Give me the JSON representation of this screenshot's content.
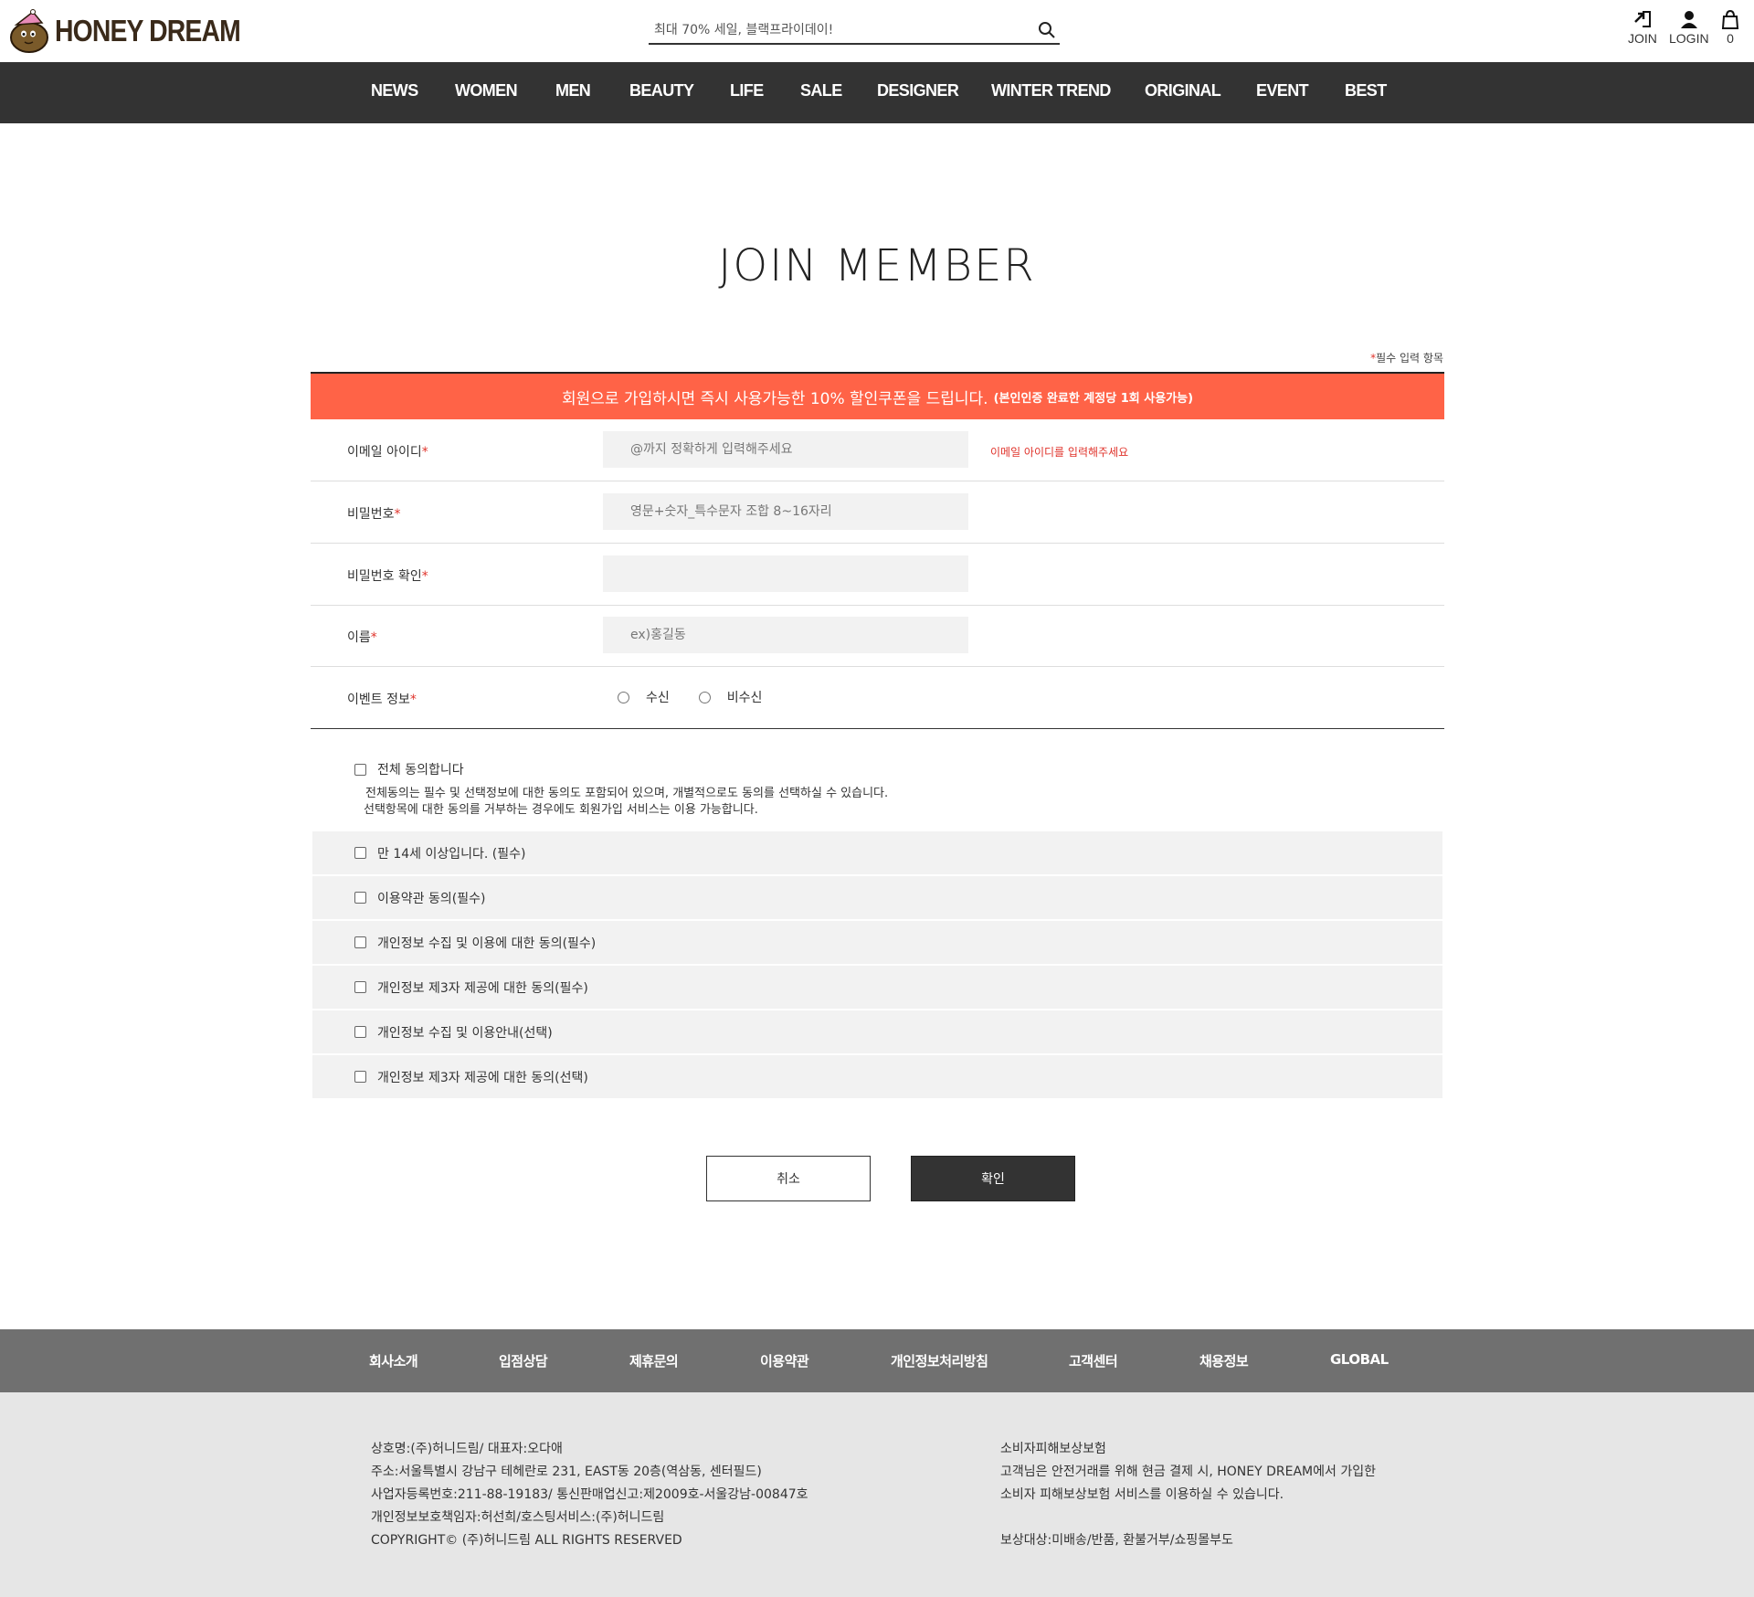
{
  "header": {
    "logo_text": "HONEY DREAM",
    "search_placeholder": "최대 70% 세일, 블랙프라이데이!",
    "join_label": "JOIN",
    "login_label": "LOGIN",
    "cart_count": "0"
  },
  "nav": {
    "items": [
      "NEWS",
      "WOMEN",
      "MEN",
      "BEAUTY",
      "LIFE",
      "SALE",
      "DESIGNER",
      "WINTER TREND",
      "ORIGINAL",
      "EVENT",
      "BEST"
    ]
  },
  "page": {
    "title": "JOIN MEMBER",
    "required_star": "*",
    "required_note": "필수 입력 항목",
    "banner_main": "회원으로 가입하시면 즉시 사용가능한 10% 할인쿠폰을 드립니다.",
    "banner_sub": "(본인인증 완료한 계정당 1회 사용가능)"
  },
  "form": {
    "email": {
      "label": "이메일 아이디",
      "placeholder": "@까지 정확하게 입력해주세요",
      "error": "이메일 아이디를 입력해주세요"
    },
    "password": {
      "label": "비밀번호",
      "placeholder": "영문+숫자_특수문자 조합 8~16자리"
    },
    "password_confirm": {
      "label": "비밀번호 확인",
      "placeholder": ""
    },
    "name": {
      "label": "이름",
      "placeholder": "ex)홍길동"
    },
    "event": {
      "label": "이벤트 정보",
      "option_yes": "수신",
      "option_no": "비수신"
    }
  },
  "agreements": {
    "all_label": "전체 동의합니다",
    "all_desc_1": "전체동의는 필수 및 선택정보에 대한 동의도 포함되어 있으며, 개별적으로도 동의를 선택하실 수 있습니다.",
    "all_desc_2": "선택항목에 대한 동의를 거부하는 경우에도 회원가입 서비스는 이용 가능합니다.",
    "items": [
      "만 14세 이상입니다. (필수)",
      "이용약관 동의(필수)",
      "개인정보 수집 및 이용에 대한 동의(필수)",
      "개인정보 제3자 제공에 대한 동의(필수)",
      "개인정보 수집 및 이용안내(선택)",
      "개인정보 제3자 제공에 대한 동의(선택)"
    ]
  },
  "buttons": {
    "cancel": "취소",
    "confirm": "확인"
  },
  "footer": {
    "nav": [
      "회사소개",
      "입점상담",
      "제휴문의",
      "이용약관",
      "개인정보처리방침",
      "고객센터",
      "채용정보",
      "GLOBAL"
    ],
    "company": [
      "상호명:(주)허니드림/ 대표자:오다애",
      "주소:서울특별시 강남구 테헤란로 231, EAST동 20층(역삼동, 센터필드)",
      "사업자등록번호:211-88-19183/ 통신판매업신고:제2009호-서울강남-00847호",
      "개인정보보호책임자:허선희/호스팅서비스:(주)허니드림",
      "COPYRIGHT© (주)허니드림 ALL RIGHTS RESERVED"
    ],
    "insurance": [
      "소비자피해보상보험",
      "고객님은 안전거래를 위해 현금 결제 시, HONEY DREAM에서 가입한",
      "소비자 피해보상보험 서비스를 이용하실 수 있습니다.",
      "",
      "보상대상:미배송/반품, 환불거부/쇼핑몰부도"
    ]
  },
  "colors": {
    "nav_bg": "#333333",
    "banner_bg": "#ff6347",
    "required_red": "#e0332b",
    "footer_nav_bg": "#707070",
    "footer_bg": "#e6e6e6"
  }
}
